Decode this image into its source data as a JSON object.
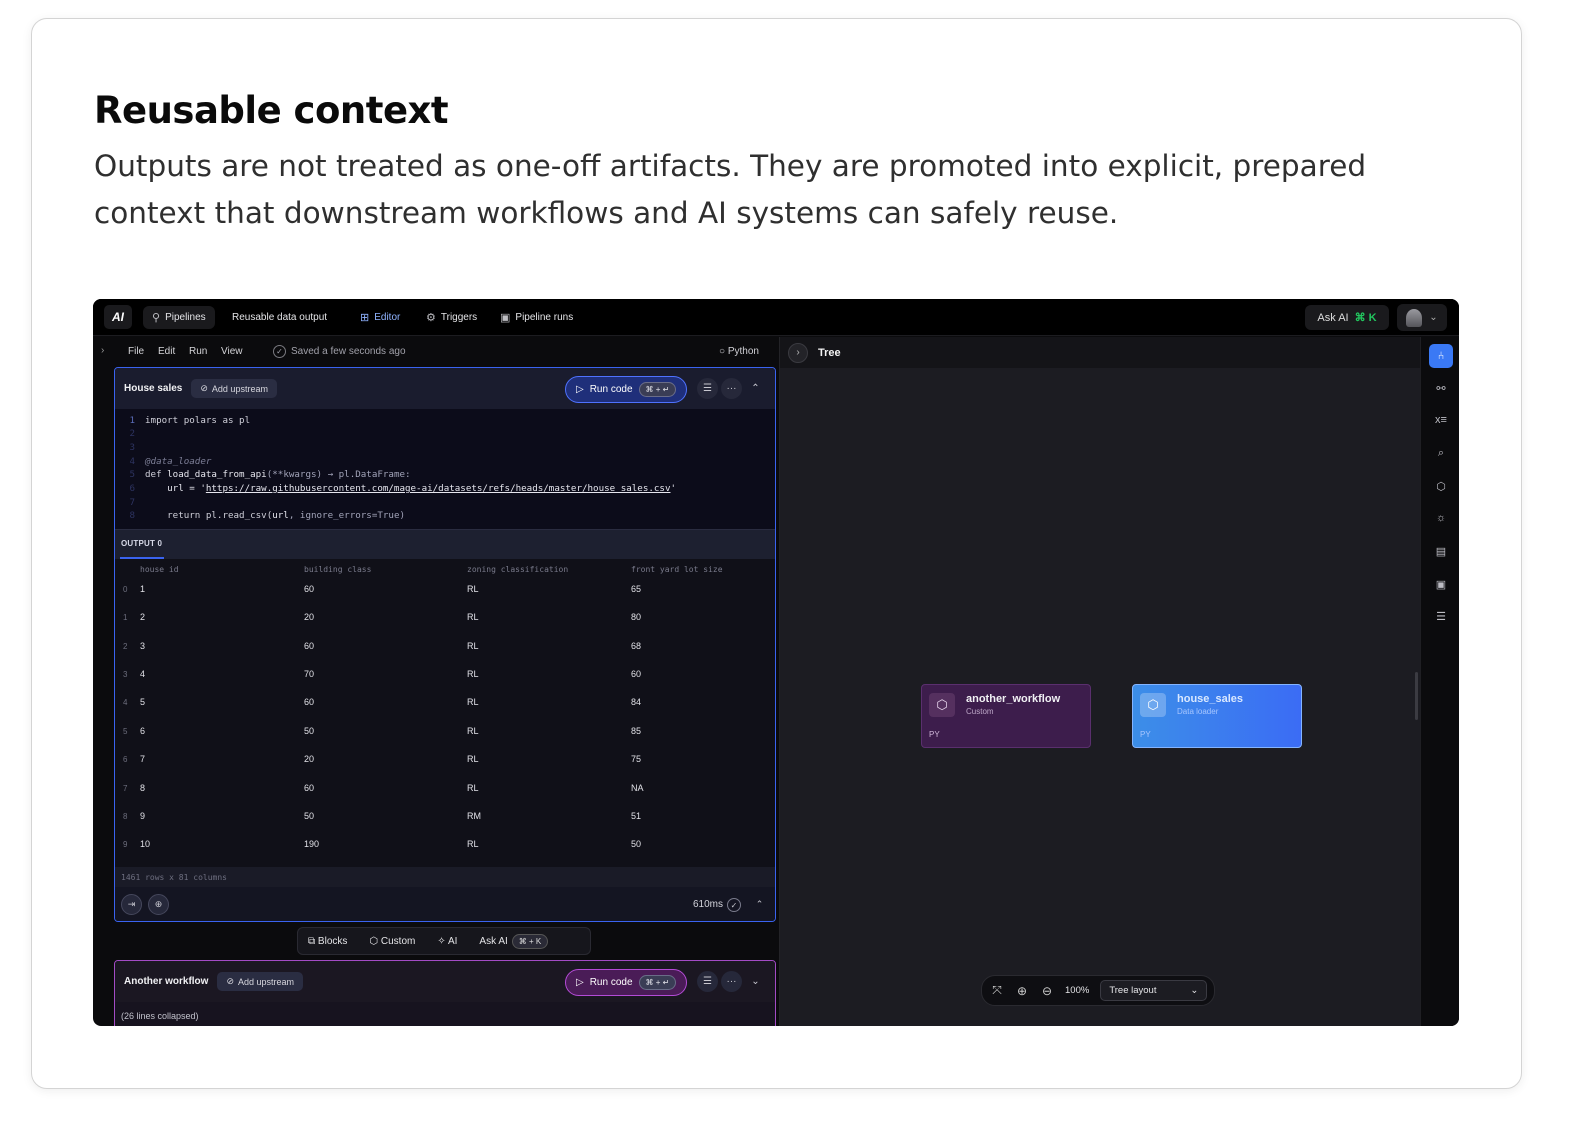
{
  "card": {
    "title": "Reusable context",
    "description": "Outputs are not treated as one-off artifacts. They are promoted into explicit, prepared context that downstream workflows and AI systems can safely reuse."
  },
  "topbar": {
    "logo": "AI",
    "nav": [
      {
        "label": "Pipelines",
        "icon": "pipelines-icon"
      },
      {
        "label": "Reusable data output"
      },
      {
        "label": "Editor",
        "icon": "editor-icon",
        "active": true
      },
      {
        "label": "Triggers",
        "icon": "triggers-icon"
      },
      {
        "label": "Pipeline runs",
        "icon": "pipeline-runs-icon"
      }
    ],
    "ask_ai": "Ask AI",
    "ask_ai_shortcut": "⌘ K"
  },
  "menubar": {
    "items": [
      "File",
      "Edit",
      "Run",
      "View"
    ],
    "saved": "Saved a few seconds ago",
    "language": "Python"
  },
  "block1": {
    "name": "House sales",
    "add_upstream": "Add upstream",
    "run": "Run code",
    "run_shortcut": "⌘ + ↵",
    "output_tab": "OUTPUT 0",
    "columns": [
      "house id",
      "building class",
      "zoning classification",
      "front yard lot size"
    ],
    "rows": [
      [
        "0",
        "1",
        "60",
        "RL",
        "65"
      ],
      [
        "1",
        "2",
        "20",
        "RL",
        "80"
      ],
      [
        "2",
        "3",
        "60",
        "RL",
        "68"
      ],
      [
        "3",
        "4",
        "70",
        "RL",
        "60"
      ],
      [
        "4",
        "5",
        "60",
        "RL",
        "84"
      ],
      [
        "5",
        "6",
        "50",
        "RL",
        "85"
      ],
      [
        "6",
        "7",
        "20",
        "RL",
        "75"
      ],
      [
        "7",
        "8",
        "60",
        "RL",
        "NA"
      ],
      [
        "8",
        "9",
        "50",
        "RM",
        "51"
      ],
      [
        "9",
        "10",
        "190",
        "RL",
        "50"
      ]
    ],
    "shape": "1461 rows x 81 columns",
    "duration": "610ms"
  },
  "code": {
    "line1_num": "1",
    "line1": "import polars as pl",
    "line2_num": "2",
    "line3_num": "3",
    "line4_num": "4",
    "line4": "@data_loader",
    "line5_num": "5",
    "line5a": "def ",
    "line5b": "load_data_from_api",
    "line5c": "(**kwargs) → pl.DataFrame:",
    "line6_num": "6",
    "line6a": "    url = '",
    "line6b": "https://raw.githubusercontent.com/mage-ai/datasets/refs/heads/master/house_sales.csv",
    "line6c": "'",
    "line7_num": "7",
    "line8_num": "8",
    "line8a": "    return pl.read_csv(",
    "line8b": "url",
    "line8c": ", ignore_errors=True)"
  },
  "dock": {
    "blocks": "Blocks",
    "custom": "Custom",
    "ai": "AI",
    "ask_ai": "Ask AI",
    "shortcut": "⌘ + K"
  },
  "block2": {
    "name": "Another workflow",
    "add_upstream": "Add upstream",
    "run": "Run code",
    "run_shortcut": "⌘ + ↵",
    "collapsed": "(26 lines collapsed)"
  },
  "tree": {
    "title": "Tree",
    "nodes": [
      {
        "name": "another_workflow",
        "type": "Custom",
        "lang": "PY"
      },
      {
        "name": "house_sales",
        "type": "Data loader",
        "lang": "PY"
      }
    ],
    "zoom": "100%",
    "layout": "Tree layout"
  },
  "colors": {
    "accent_blue": "#3a63f0",
    "accent_purple": "#a34bc5",
    "shortcut_green": "#22c55e",
    "node_blue": "#3b6cf5"
  }
}
